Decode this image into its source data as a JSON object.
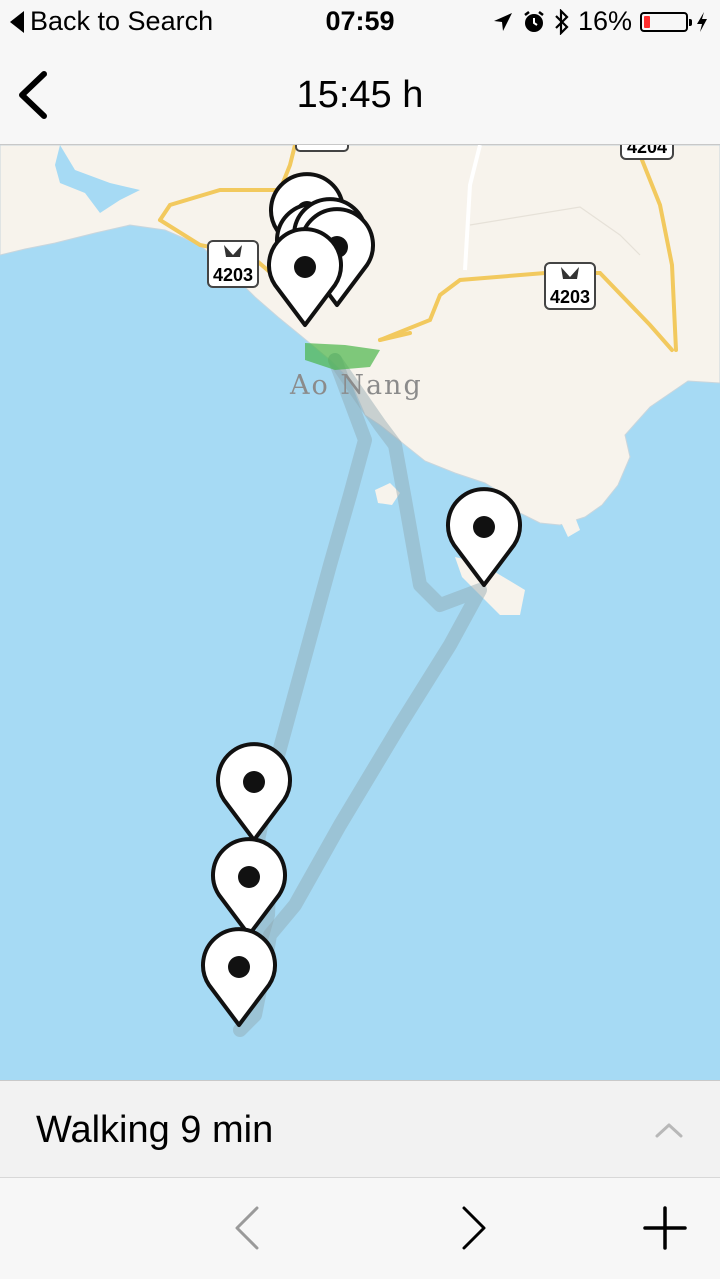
{
  "status_bar": {
    "back_label": "Back to Search",
    "time": "07:59",
    "battery_percent_label": "16%",
    "battery_level": 0.16,
    "icons": [
      "location-arrow-icon",
      "alarm-icon",
      "bluetooth-icon",
      "battery-icon",
      "charging-bolt-icon"
    ]
  },
  "header": {
    "title": "15:45 h",
    "back_icon": "chevron-left-icon"
  },
  "map": {
    "place_label": "Ao Nang",
    "route_shields": [
      "4203",
      "4203",
      "4204"
    ],
    "pin_count": 8,
    "colors": {
      "water": "#a6daf4",
      "land": "#f7f3ec",
      "road": "#f2c95e",
      "route": "#8ea6b0"
    }
  },
  "sheet": {
    "title": "Walking 9 min",
    "expand_icon": "chevron-up-icon"
  },
  "toolbar": {
    "prev_icon": "chevron-left-icon",
    "next_icon": "chevron-right-icon",
    "add_icon": "plus-icon"
  }
}
